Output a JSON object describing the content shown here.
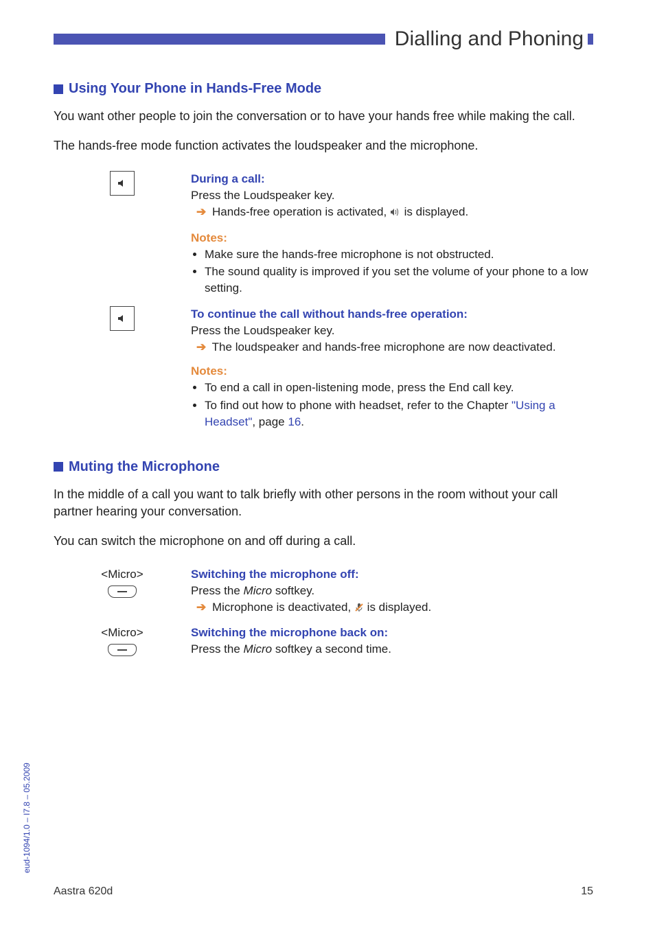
{
  "header": {
    "title": "Dialling and Phoning"
  },
  "section1": {
    "heading": "Using Your Phone in Hands-Free Mode",
    "p1": "You want other people to join the conversation or to have your hands free while making the call.",
    "p2": "The hands-free mode function activates the loudspeaker and the microphone.",
    "block1": {
      "title": "During a call:",
      "line1": "Press the Loudspeaker key.",
      "result_prefix": "Hands-free operation is activated, ",
      "result_suffix": " is displayed."
    },
    "notes1": {
      "label": "Notes:",
      "items": [
        "Make sure the hands-free microphone is not obstructed.",
        "The sound quality is improved if you set the volume of your phone to a low setting."
      ]
    },
    "block2": {
      "title": "To continue the call without hands-free operation:",
      "line1": "Press the Loudspeaker key.",
      "result": "The loudspeaker and hands-free microphone are now deactivated."
    },
    "notes2": {
      "label": "Notes:",
      "items_pre": "To end a call in open-listening mode, press the End call key.",
      "item2_pre": "To find out how to phone with headset, refer to the Chapter ",
      "item2_link": "\"Using a Headset\"",
      "item2_mid": ", page ",
      "item2_page": "16",
      "item2_post": "."
    }
  },
  "section2": {
    "heading": "Muting the Microphone",
    "p1": "In the middle of a call you want to talk briefly with other persons in the room without your call partner hearing your conversation.",
    "p2": "You can switch the microphone on and off during a call.",
    "block1": {
      "softkey": "<Micro>",
      "title": "Switching the microphone off:",
      "line_pre": "Press the ",
      "line_em": "Micro",
      "line_post": " softkey.",
      "result_prefix": "Microphone is deactivated, ",
      "result_suffix": " is displayed."
    },
    "block2": {
      "softkey": "<Micro>",
      "title": "Switching the microphone back on:",
      "line_pre": "Press the ",
      "line_em": "Micro",
      "line_post": " softkey a second time."
    }
  },
  "footer": {
    "model": "Aastra 620d",
    "page": "15"
  },
  "side": "eud-1094/1.0 – I7.8 – 05.2009"
}
